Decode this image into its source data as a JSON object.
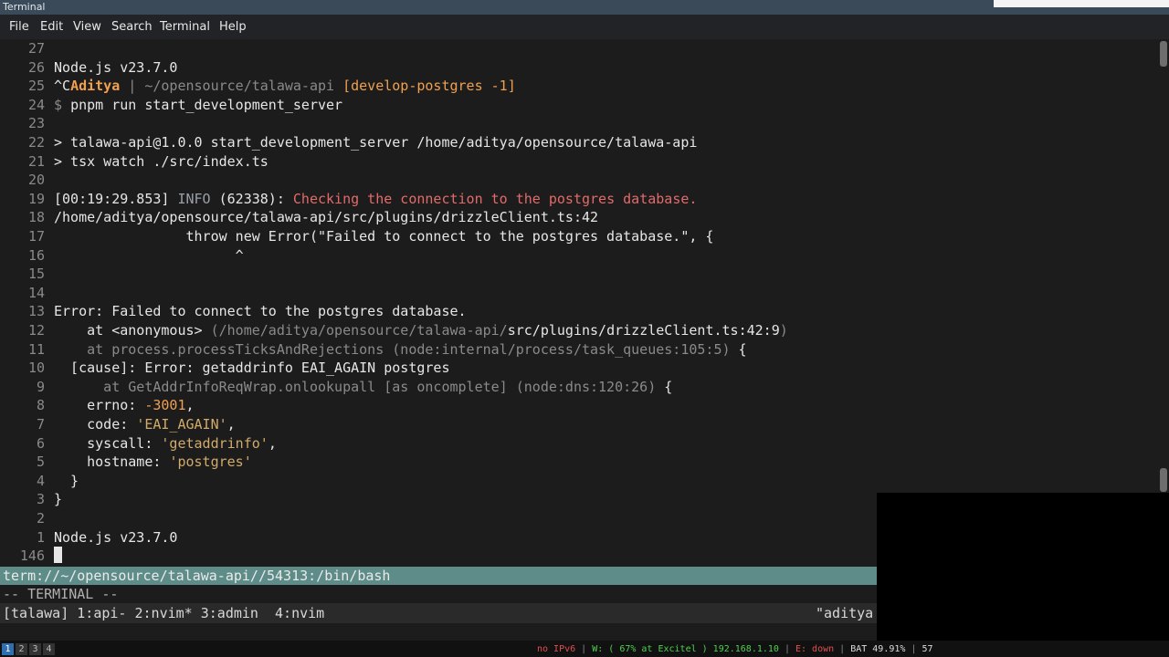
{
  "window": {
    "title": "Terminal"
  },
  "menu": [
    "File",
    "Edit",
    "View",
    "Search",
    "Terminal",
    "Help"
  ],
  "terminal_lines": [
    {
      "n": "27",
      "segs": []
    },
    {
      "n": "26",
      "segs": [
        {
          "t": "Node.js v23.7.0",
          "c": "white"
        }
      ]
    },
    {
      "n": "25",
      "segs": [
        {
          "t": "^C",
          "c": "white"
        },
        {
          "t": "Aditya",
          "c": "bold"
        },
        {
          "t": " | ",
          "c": "dim"
        },
        {
          "t": "~/opensource/talawa-api ",
          "c": "dim"
        },
        {
          "t": "[develop-postgres -1]",
          "c": "orange"
        }
      ]
    },
    {
      "n": "24",
      "segs": [
        {
          "t": "$ ",
          "c": "dim"
        },
        {
          "t": "pnpm run start_development_server",
          "c": "white"
        }
      ]
    },
    {
      "n": "23",
      "segs": []
    },
    {
      "n": "22",
      "segs": [
        {
          "t": "> talawa-api@1.0.0 start_development_server /home/aditya/opensource/talawa-api",
          "c": "white"
        }
      ]
    },
    {
      "n": "21",
      "segs": [
        {
          "t": "> tsx watch ./src/index.ts",
          "c": "white"
        }
      ]
    },
    {
      "n": "20",
      "segs": []
    },
    {
      "n": "19",
      "segs": [
        {
          "t": "[00:19:29.853] ",
          "c": "white"
        },
        {
          "t": "INFO",
          "c": "info"
        },
        {
          "t": " (62338): ",
          "c": "white"
        },
        {
          "t": "Checking the connection to the postgres database.",
          "c": "red"
        }
      ]
    },
    {
      "n": "18",
      "segs": [
        {
          "t": "/home/aditya/opensource/talawa-api/src/plugins/drizzleClient.ts:42",
          "c": "white"
        }
      ]
    },
    {
      "n": "17",
      "segs": [
        {
          "t": "                throw new Error(\"Failed to connect to the postgres database.\", {",
          "c": "white"
        }
      ]
    },
    {
      "n": "16",
      "segs": [
        {
          "t": "                      ^",
          "c": "white"
        }
      ]
    },
    {
      "n": "15",
      "segs": []
    },
    {
      "n": "14",
      "segs": []
    },
    {
      "n": "13",
      "segs": [
        {
          "t": "Error: Failed to connect to the postgres database.",
          "c": "white"
        }
      ]
    },
    {
      "n": "12",
      "segs": [
        {
          "t": "    at <anonymous> ",
          "c": "white"
        },
        {
          "t": "(/home/aditya/opensource/talawa-api/",
          "c": "dim"
        },
        {
          "t": "src/plugins/drizzleClient.ts:42:9",
          "c": "white"
        },
        {
          "t": ")",
          "c": "dim"
        }
      ]
    },
    {
      "n": "11",
      "segs": [
        {
          "t": "    at process.processTicksAndRejections (node:internal/process/task_queues:105:5)",
          "c": "dim"
        },
        {
          "t": " {",
          "c": "white"
        }
      ]
    },
    {
      "n": "10",
      "segs": [
        {
          "t": "  [cause]: Error: getaddrinfo EAI_AGAIN postgres",
          "c": "white"
        }
      ]
    },
    {
      "n": "9",
      "segs": [
        {
          "t": "      at GetAddrInfoReqWrap.onlookupall [as oncomplete] (node:dns:120:26)",
          "c": "dim"
        },
        {
          "t": " {",
          "c": "white"
        }
      ]
    },
    {
      "n": "8",
      "segs": [
        {
          "t": "    errno: ",
          "c": "white"
        },
        {
          "t": "-3001",
          "c": "orange"
        },
        {
          "t": ",",
          "c": "white"
        }
      ]
    },
    {
      "n": "7",
      "segs": [
        {
          "t": "    code: ",
          "c": "white"
        },
        {
          "t": "'EAI_AGAIN'",
          "c": "green"
        },
        {
          "t": ",",
          "c": "white"
        }
      ]
    },
    {
      "n": "6",
      "segs": [
        {
          "t": "    syscall: ",
          "c": "white"
        },
        {
          "t": "'getaddrinfo'",
          "c": "green"
        },
        {
          "t": ",",
          "c": "white"
        }
      ]
    },
    {
      "n": "5",
      "segs": [
        {
          "t": "    hostname: ",
          "c": "white"
        },
        {
          "t": "'postgres'",
          "c": "green"
        }
      ]
    },
    {
      "n": "4",
      "segs": [
        {
          "t": "  }",
          "c": "white"
        }
      ]
    },
    {
      "n": "3",
      "segs": [
        {
          "t": "}",
          "c": "white"
        }
      ]
    },
    {
      "n": "2",
      "segs": []
    },
    {
      "n": "1",
      "segs": [
        {
          "t": "Node.js v23.7.0",
          "c": "white"
        }
      ]
    },
    {
      "n": "146",
      "segs": [],
      "cursor": true
    }
  ],
  "statusline": "term://~/opensource/talawa-api//54313:/bin/bash",
  "mode": "-- TERMINAL --",
  "tabline": {
    "session": "[talawa] 1:api- 2:nvim* 3:admin  4:nvim",
    "right": "\"aditya"
  },
  "workspaces": [
    "1",
    "2",
    "3",
    "4"
  ],
  "system_status": [
    {
      "t": "no IPv6",
      "color": "#e05050"
    },
    {
      "t": " | ",
      "color": "#888888"
    },
    {
      "t": "W: ( 67% at Excitel ) 192.168.1.10",
      "color": "#50d050"
    },
    {
      "t": " | ",
      "color": "#888888"
    },
    {
      "t": "E: down",
      "color": "#e05050"
    },
    {
      "t": " | ",
      "color": "#888888"
    },
    {
      "t": "BAT 49.91%",
      "color": "#dddddd"
    },
    {
      "t": " | ",
      "color": "#888888"
    },
    {
      "t": "57",
      "color": "#dddddd"
    }
  ]
}
